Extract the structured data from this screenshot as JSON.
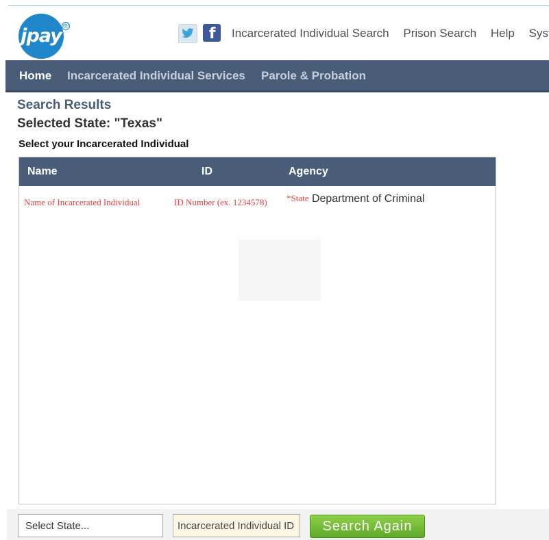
{
  "brand": {
    "logo_text": "jpay",
    "registered_mark": "®",
    "color": "#1f86c9"
  },
  "social": {
    "twitter_icon": "twitter-icon",
    "facebook_icon": "facebook-icon",
    "facebook_glyph": "f"
  },
  "top_links": [
    "Incarcerated Individual Search",
    "Prison Search",
    "Help",
    "Syst"
  ],
  "nav": {
    "items": [
      {
        "label": "Home",
        "active": true
      },
      {
        "label": "Incarcerated Individual Services",
        "active": false
      },
      {
        "label": "Parole & Probation",
        "active": false
      }
    ],
    "color": "#4a5d78"
  },
  "page": {
    "heading": "Search Results",
    "selected_state": "Selected State: \"Texas\"",
    "instruction": "Select your Incarcerated Individual"
  },
  "table": {
    "columns": [
      "Name",
      "ID",
      "Agency"
    ],
    "hints": {
      "name": "Name of Incarcerated Individual",
      "id": "ID Number (ex. 1234578)",
      "agency_prefix": "*State",
      "agency_text": "Department of Criminal"
    }
  },
  "form": {
    "state_select": "Select State...",
    "id_placeholder": "Incarcerated Individual ID",
    "search_button": "Search Again",
    "button_color": "#6bb52f"
  }
}
